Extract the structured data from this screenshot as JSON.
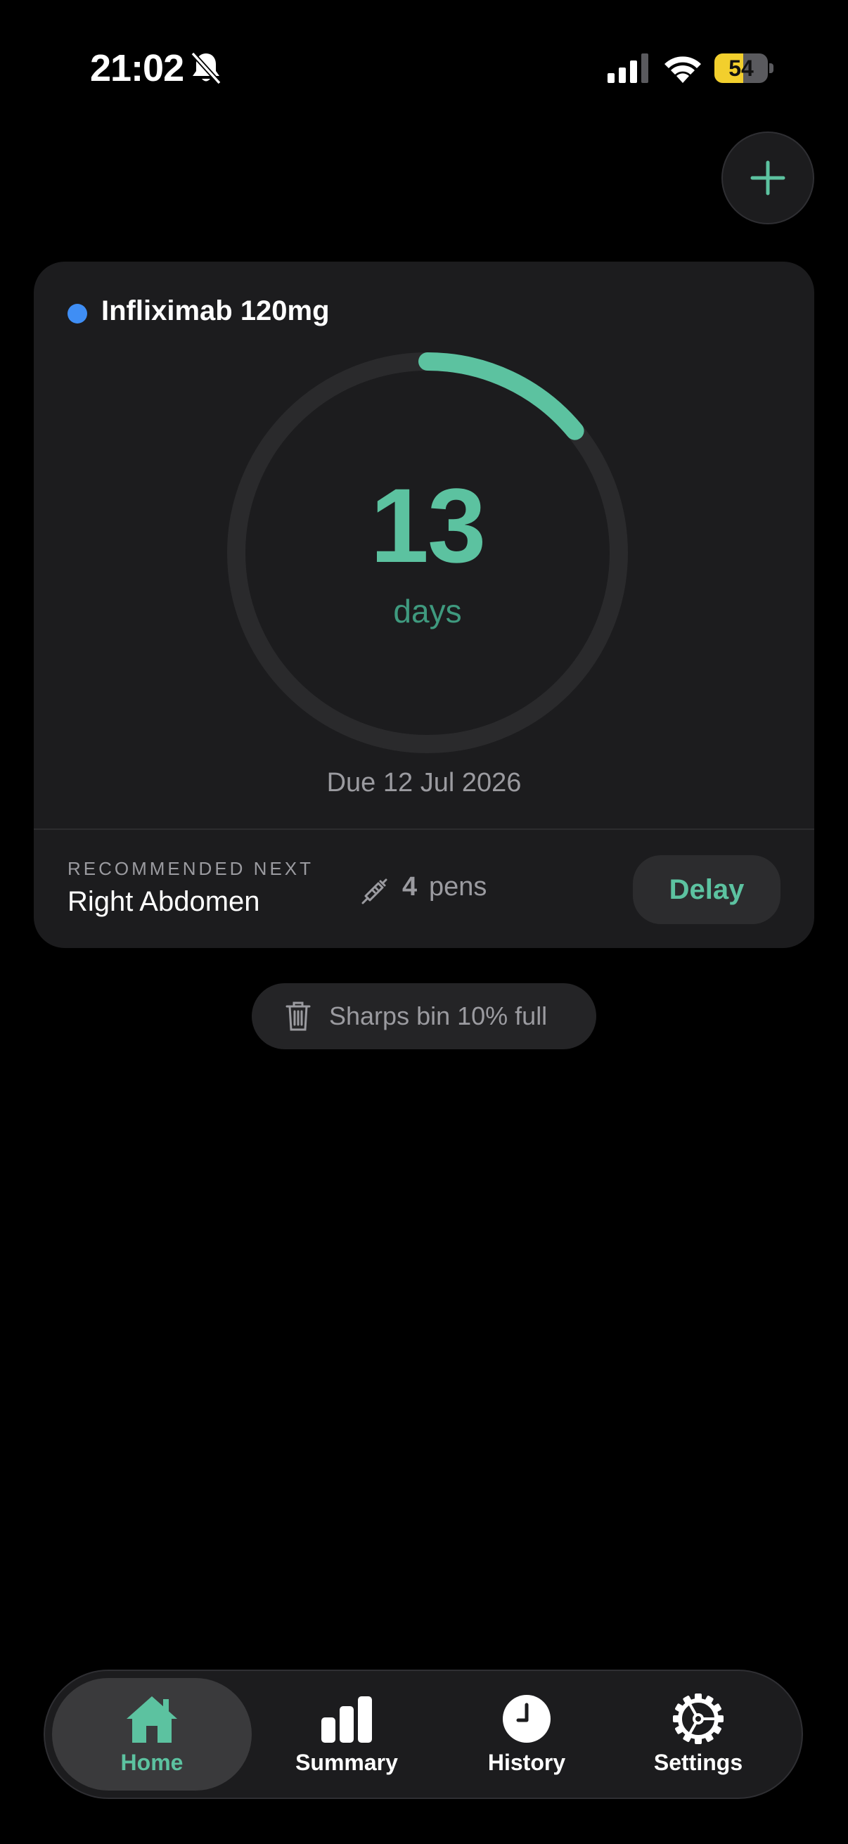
{
  "status_bar": {
    "time": "21:02",
    "battery_percent": "54",
    "battery_level": 0.54,
    "icons": [
      "bell-slash-icon",
      "cellular-signal-icon",
      "wifi-icon",
      "battery-icon"
    ]
  },
  "header": {
    "add_icon": "plus-icon"
  },
  "medication_card": {
    "name": "Infliximab 120mg",
    "dot_color": "#3f8ef5",
    "days_remaining": "13",
    "days_unit": "days",
    "ring_progress": 0.14,
    "due_text": "Due 12 Jul 2026",
    "recommended_label": "RECOMMENDED NEXT",
    "recommended_site": "Right Abdomen",
    "pens_count": "4",
    "pens_label": "pens",
    "delay_label": "Delay"
  },
  "sharps": {
    "text": "Sharps bin 10% full"
  },
  "tabs": [
    {
      "label": "Home",
      "icon": "house-icon",
      "active": true
    },
    {
      "label": "Summary",
      "icon": "bar-chart-icon",
      "active": false
    },
    {
      "label": "History",
      "icon": "clock-icon",
      "active": false
    },
    {
      "label": "Settings",
      "icon": "gear-icon",
      "active": false
    }
  ],
  "colors": {
    "accent": "#5cc2a0",
    "card_bg": "#1c1c1e",
    "battery_yellow": "#f2cf2d"
  }
}
